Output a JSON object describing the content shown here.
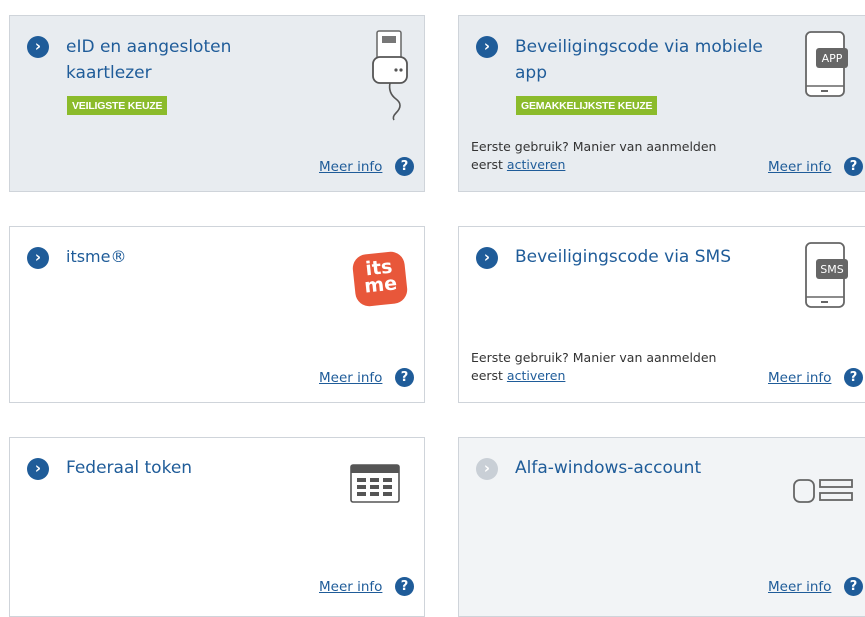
{
  "cards": [
    {
      "title_line1": "eID en aangesloten",
      "title_line2": "kaartlezer",
      "badge": "VEILIGSTE KEUZE",
      "meer_info": "Meer info",
      "icon": "card-reader-icon"
    },
    {
      "title_line1": "Beveiligingscode via mobiele",
      "title_line2": "app",
      "badge": "GEMAKKELIJKSTE KEUZE",
      "note_line1": "Eerste gebruik? Manier van aanmelden",
      "note_line2_prefix": "eerst",
      "note_link": "activeren",
      "meer_info": "Meer info",
      "icon_label": "APP",
      "icon": "phone-app-icon"
    },
    {
      "title": "itsme®",
      "logo_line1": "its",
      "logo_line2": "me",
      "meer_info": "Meer info",
      "icon": "itsme-logo"
    },
    {
      "title": "Beveiligingscode via SMS",
      "note_line1": "Eerste gebruik? Manier van aanmelden",
      "note_line2_prefix": "eerst",
      "note_link": "activeren",
      "meer_info": "Meer info",
      "icon_label": "SMS",
      "icon": "phone-sms-icon"
    },
    {
      "title": "Federaal token",
      "meer_info": "Meer info",
      "icon": "token-card-icon"
    },
    {
      "title": "Alfa-windows-account",
      "meer_info": "Meer info",
      "icon": "windows-account-icon"
    }
  ],
  "help_glyph": "?",
  "chevron_glyph": "›",
  "colors": {
    "primary": "#1f5c99",
    "badge": "#8bbb2b",
    "itsme": "#e8573a"
  }
}
